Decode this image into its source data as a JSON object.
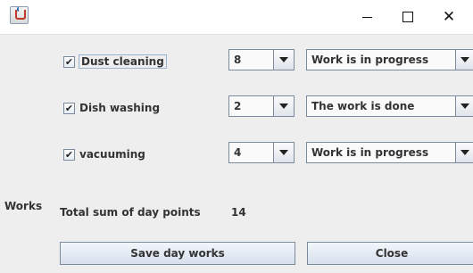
{
  "window": {
    "title": "",
    "icon": "java-cup-icon",
    "controls": {
      "minimize": "minimize-icon",
      "maximize": "maximize-icon",
      "close_glyph": "✕"
    }
  },
  "tasks": [
    {
      "label": "Dust cleaning",
      "checked": true,
      "points": "8",
      "status": "Work is in progress"
    },
    {
      "label": "Dish washing",
      "checked": true,
      "points": "2",
      "status": "The work is done"
    },
    {
      "label": "vacuuming",
      "checked": true,
      "points": "4",
      "status": "Work is in progress"
    }
  ],
  "check_glyph": "✔",
  "works_label": "Works",
  "total": {
    "label": "Total sum of day points",
    "value": "14"
  },
  "buttons": {
    "save": "Save day works",
    "close": "Close"
  }
}
